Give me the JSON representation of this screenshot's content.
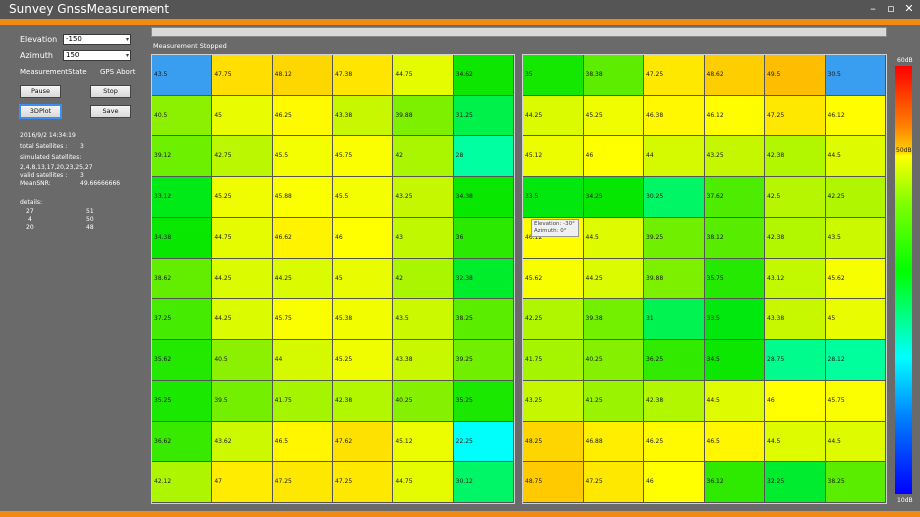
{
  "app": {
    "title": "Sunvey GnssMeasurement",
    "version": "v1.2.3",
    "minimize": "–",
    "maximize": "▫",
    "close": "✕"
  },
  "controls": {
    "elevation_label": "Elevation",
    "elevation_value": "-150",
    "azimuth_label": "Azimuth",
    "azimuth_value": "150",
    "state_label": "MeasurementState",
    "state_value": "GPS Abort",
    "pause": "Pause",
    "stop": "Stop",
    "plot3d": "3DPlot",
    "save": "Save"
  },
  "info": {
    "datetime": "2016/9/2 14:34:19",
    "total_sat_label": "total Satellites :",
    "total_sat_value": "3",
    "sim_label": "simulated Satellites:",
    "sim_list": "2,4,8,13,17,20,23,25,27",
    "valid_label": "valid satellites :",
    "valid_value": "3",
    "snr_label": "MeanSNR:",
    "snr_value": "49.66666666",
    "details_label": "details:",
    "details": [
      [
        "27",
        "51"
      ],
      [
        "4",
        "50"
      ],
      [
        "20",
        "48"
      ]
    ]
  },
  "status": "Measurement Stopped",
  "tooltip": {
    "line1": "Elevation: -30°",
    "line2": "Azimuth: 0°"
  },
  "scale": {
    "top": "60dB",
    "mid": "50dB",
    "bottom": "10dB"
  },
  "colors": {
    "low": "#0000ff",
    "mid": "#00ff00",
    "high": "#ffff00",
    "max": "#ff0000"
  },
  "grid_left": [
    [
      "43.5",
      "47.75",
      "48.12",
      "47.38",
      "44.75",
      "34.62"
    ],
    [
      "40.5",
      "45",
      "46.25",
      "43.38",
      "39.88",
      "31.25"
    ],
    [
      "39.12",
      "42.75",
      "45.5",
      "45.75",
      "42",
      "28"
    ],
    [
      "33.12",
      "45.25",
      "45.88",
      "45.5",
      "43.25",
      "34.38"
    ],
    [
      "34.38",
      "44.75",
      "46.62",
      "46",
      "43",
      "36"
    ],
    [
      "38.62",
      "44.25",
      "44.25",
      "45",
      "42",
      "32.38"
    ],
    [
      "37.25",
      "44.25",
      "45.75",
      "45.38",
      "43.5",
      "38.25"
    ],
    [
      "35.62",
      "40.5",
      "44",
      "45.25",
      "43.38",
      "39.25"
    ],
    [
      "35.25",
      "39.5",
      "41.75",
      "42.38",
      "40.25",
      "35.25"
    ],
    [
      "36.62",
      "43.62",
      "46.5",
      "47.62",
      "45.12",
      "22.25"
    ],
    [
      "42.12",
      "47",
      "47.25",
      "47.25",
      "44.75",
      "30.12"
    ]
  ],
  "grid_right": [
    [
      "35",
      "38.38",
      "47.25",
      "48.62",
      "49.5",
      "30.5"
    ],
    [
      "44.25",
      "45.25",
      "46.38",
      "46.12",
      "47.25",
      "46.12"
    ],
    [
      "45.12",
      "46",
      "44",
      "43.25",
      "42.38",
      "44.5"
    ],
    [
      "33.5",
      "34.25",
      "30.25",
      "37.62",
      "42.5",
      "42.25"
    ],
    [
      "46.12",
      "44.5",
      "39.25",
      "38.12",
      "42.38",
      "43.5"
    ],
    [
      "45.62",
      "44.25",
      "39.88",
      "35.75",
      "43.12",
      "45.62"
    ],
    [
      "42.25",
      "39.38",
      "31",
      "33.5",
      "43.38",
      "45"
    ],
    [
      "41.75",
      "40.25",
      "36.25",
      "34.5",
      "28.75",
      "28.12"
    ],
    [
      "43.25",
      "41.25",
      "42.38",
      "44.5",
      "46",
      "45.75"
    ],
    [
      "48.25",
      "46.88",
      "46.25",
      "46.5",
      "44.5",
      "44.5"
    ],
    [
      "48.75",
      "47.25",
      "46",
      "36.12",
      "32.25",
      "38.25"
    ]
  ]
}
